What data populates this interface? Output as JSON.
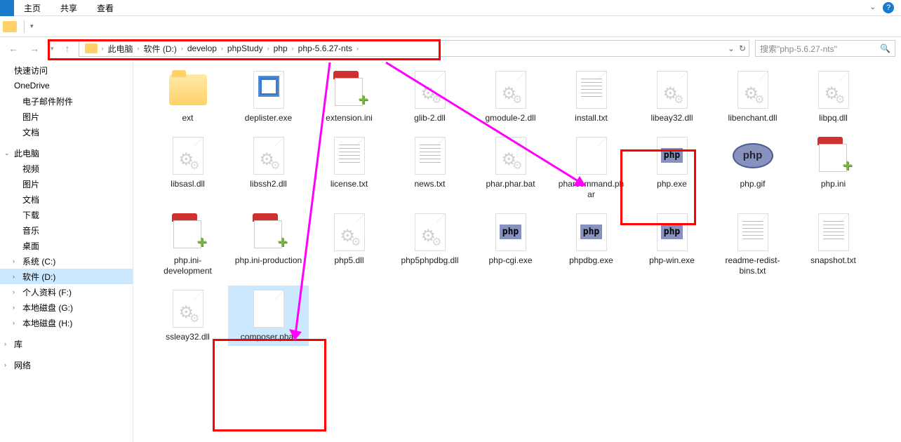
{
  "ribbon": {
    "tabs": [
      "主页",
      "共享",
      "查看"
    ],
    "help": "?"
  },
  "breadcrumb": [
    "此电脑",
    "软件 (D:)",
    "develop",
    "phpStudy",
    "php",
    "php-5.6.27-nts"
  ],
  "search": {
    "placeholder": "搜索\"php-5.6.27-nts\""
  },
  "sidebar": {
    "top": [
      "快速访问",
      "OneDrive",
      "电子邮件附件",
      "图片",
      "文档"
    ],
    "pc": "此电脑",
    "pc_children": [
      "视频",
      "图片",
      "文档",
      "下载",
      "音乐",
      "桌面",
      "系统 (C:)",
      "软件 (D:)",
      "个人资料 (F:)",
      "本地磁盘 (G:)",
      "本地磁盘 (H:)"
    ],
    "lib": "库",
    "net": "网络"
  },
  "files": [
    {
      "name": "ext",
      "type": "folder"
    },
    {
      "name": "deplister.exe",
      "type": "exe"
    },
    {
      "name": "extension.ini",
      "type": "ini"
    },
    {
      "name": "glib-2.dll",
      "type": "dll"
    },
    {
      "name": "gmodule-2.dll",
      "type": "dll"
    },
    {
      "name": "install.txt",
      "type": "txt"
    },
    {
      "name": "libeay32.dll",
      "type": "dll"
    },
    {
      "name": "libenchant.dll",
      "type": "dll"
    },
    {
      "name": "libpq.dll",
      "type": "dll"
    },
    {
      "name": "libsasl.dll",
      "type": "dll"
    },
    {
      "name": "libssh2.dll",
      "type": "dll"
    },
    {
      "name": "license.txt",
      "type": "txt"
    },
    {
      "name": "news.txt",
      "type": "txt"
    },
    {
      "name": "phar.phar.bat",
      "type": "dll"
    },
    {
      "name": "pharcommand.phar",
      "type": "blank"
    },
    {
      "name": "php.exe",
      "type": "php"
    },
    {
      "name": "php.gif",
      "type": "phpgif"
    },
    {
      "name": "php.ini",
      "type": "ini"
    },
    {
      "name": "php.ini-development",
      "type": "ini"
    },
    {
      "name": "php.ini-production",
      "type": "ini"
    },
    {
      "name": "php5.dll",
      "type": "dll"
    },
    {
      "name": "php5phpdbg.dll",
      "type": "dll"
    },
    {
      "name": "php-cgi.exe",
      "type": "php"
    },
    {
      "name": "phpdbg.exe",
      "type": "php"
    },
    {
      "name": "php-win.exe",
      "type": "php"
    },
    {
      "name": "readme-redist-bins.txt",
      "type": "txt"
    },
    {
      "name": "snapshot.txt",
      "type": "txt"
    },
    {
      "name": "ssleay32.dll",
      "type": "dll"
    },
    {
      "name": "composer.phar",
      "type": "blank",
      "selected": true
    }
  ]
}
